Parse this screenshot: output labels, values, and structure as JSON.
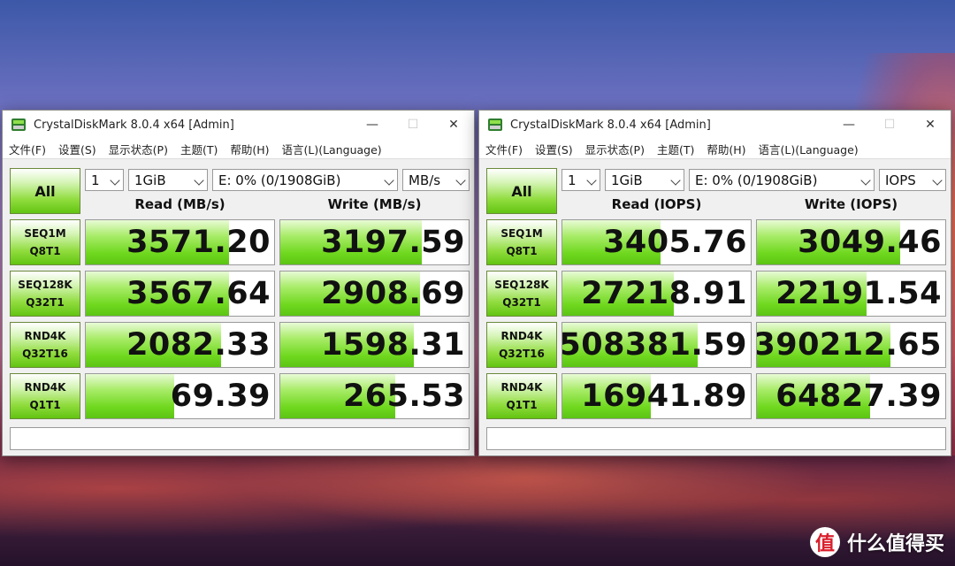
{
  "windows": [
    {
      "title": "CrystalDiskMark 8.0.4 x64 [Admin]",
      "menu": [
        "文件(F)",
        "设置(S)",
        "显示状态(P)",
        "主题(T)",
        "帮助(H)",
        "语言(L)(Language)"
      ],
      "all_button": "All",
      "count": "1",
      "size": "1GiB",
      "drive": "E: 0% (0/1908GiB)",
      "unit": "MB/s",
      "read_header": "Read (MB/s)",
      "write_header": "Write (MB/s)",
      "rows": [
        {
          "label1": "SEQ1M",
          "label2": "Q8T1",
          "read": "3571.20",
          "write": "3197.59",
          "read_fill": 0.76,
          "write_fill": 0.75
        },
        {
          "label1": "SEQ128K",
          "label2": "Q32T1",
          "read": "3567.64",
          "write": "2908.69",
          "read_fill": 0.76,
          "write_fill": 0.74
        },
        {
          "label1": "RND4K",
          "label2": "Q32T16",
          "read": "2082.33",
          "write": "1598.31",
          "read_fill": 0.72,
          "write_fill": 0.71
        },
        {
          "label1": "RND4K",
          "label2": "Q1T1",
          "read": "69.39",
          "write": "265.53",
          "read_fill": 0.47,
          "write_fill": 0.61
        }
      ],
      "comment": ""
    },
    {
      "title": "CrystalDiskMark 8.0.4 x64 [Admin]",
      "menu": [
        "文件(F)",
        "设置(S)",
        "显示状态(P)",
        "主题(T)",
        "帮助(H)",
        "语言(L)(Language)"
      ],
      "all_button": "All",
      "count": "1",
      "size": "1GiB",
      "drive": "E: 0% (0/1908GiB)",
      "unit": "IOPS",
      "read_header": "Read (IOPS)",
      "write_header": "Write (IOPS)",
      "rows": [
        {
          "label1": "SEQ1M",
          "label2": "Q8T1",
          "read": "3405.76",
          "write": "3049.46",
          "read_fill": 0.52,
          "write_fill": 0.76
        },
        {
          "label1": "SEQ128K",
          "label2": "Q32T1",
          "read": "27218.91",
          "write": "22191.54",
          "read_fill": 0.59,
          "write_fill": 0.58
        },
        {
          "label1": "RND4K",
          "label2": "Q32T16",
          "read": "508381.59",
          "write": "390212.65",
          "read_fill": 0.72,
          "write_fill": 0.71
        },
        {
          "label1": "RND4K",
          "label2": "Q1T1",
          "read": "16941.89",
          "write": "64827.39",
          "read_fill": 0.47,
          "write_fill": 0.6
        }
      ],
      "comment": ""
    }
  ],
  "titlebar_controls": {
    "minimize": "—",
    "maximize": "☐",
    "close": "✕"
  },
  "watermark": {
    "badge": "值",
    "text": "什么值得买"
  },
  "colors": {
    "accent_green": "#6fd81e",
    "window_bg": "#f0f0f0"
  }
}
